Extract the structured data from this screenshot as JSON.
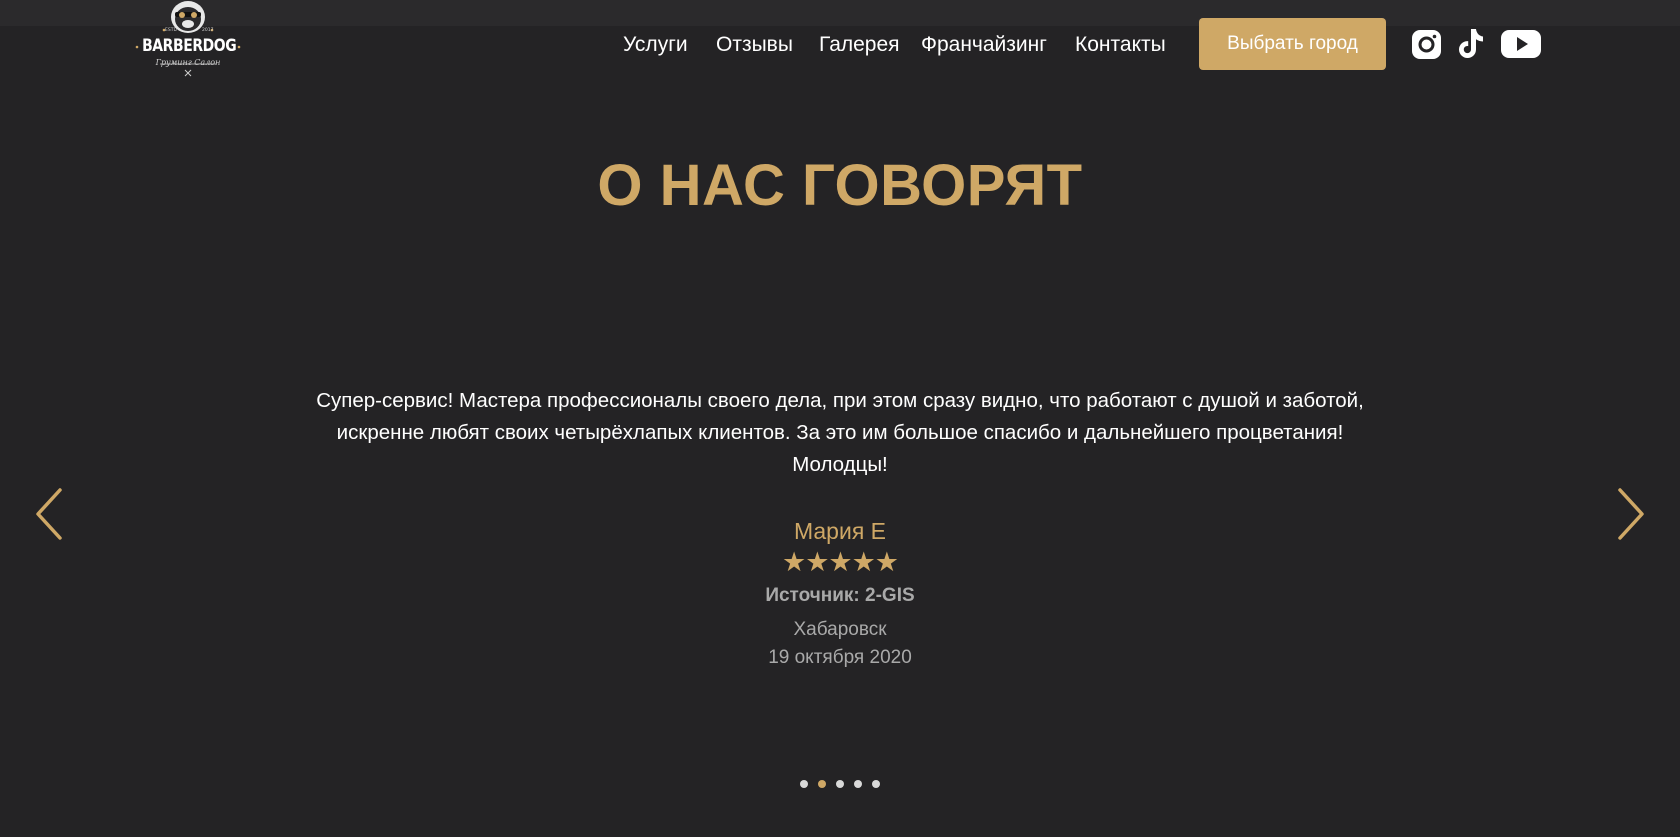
{
  "header": {
    "logo": {
      "wordmark": "BARBERDOG",
      "subtitle": "Груминг Салон",
      "badge_left": "ESTD",
      "badge_right": "2017"
    },
    "nav": [
      {
        "label": "Услуги"
      },
      {
        "label": "Отзывы"
      },
      {
        "label": "Галерея"
      },
      {
        "label": "Франчайзинг"
      },
      {
        "label": "Контакты"
      }
    ],
    "city_button": "Выбрать город",
    "social": [
      "instagram-icon",
      "tiktok-icon",
      "youtube-icon"
    ]
  },
  "reviews": {
    "title": "О НАС ГОВОРЯТ",
    "current": {
      "text": "Супер-сервис! Мастера профессионалы своего дела, при этом сразу видно, что работают с душой и заботой, искренне любят своих четырёхлапых клиентов. За это им большое спасибо и дальнейшего процветания! Молодцы!",
      "author": "Мария Е",
      "rating": 5,
      "rating_max": 5,
      "stars": "★★★★★",
      "source": "Источник: 2-GIS",
      "city": "Хабаровск",
      "date": "19 октября 2020"
    },
    "pagination": {
      "total": 5,
      "active_index": 1
    }
  },
  "colors": {
    "background": "#242325",
    "accent": "#cfa866",
    "text": "#ffffff",
    "muted": "#a9a9a9"
  }
}
